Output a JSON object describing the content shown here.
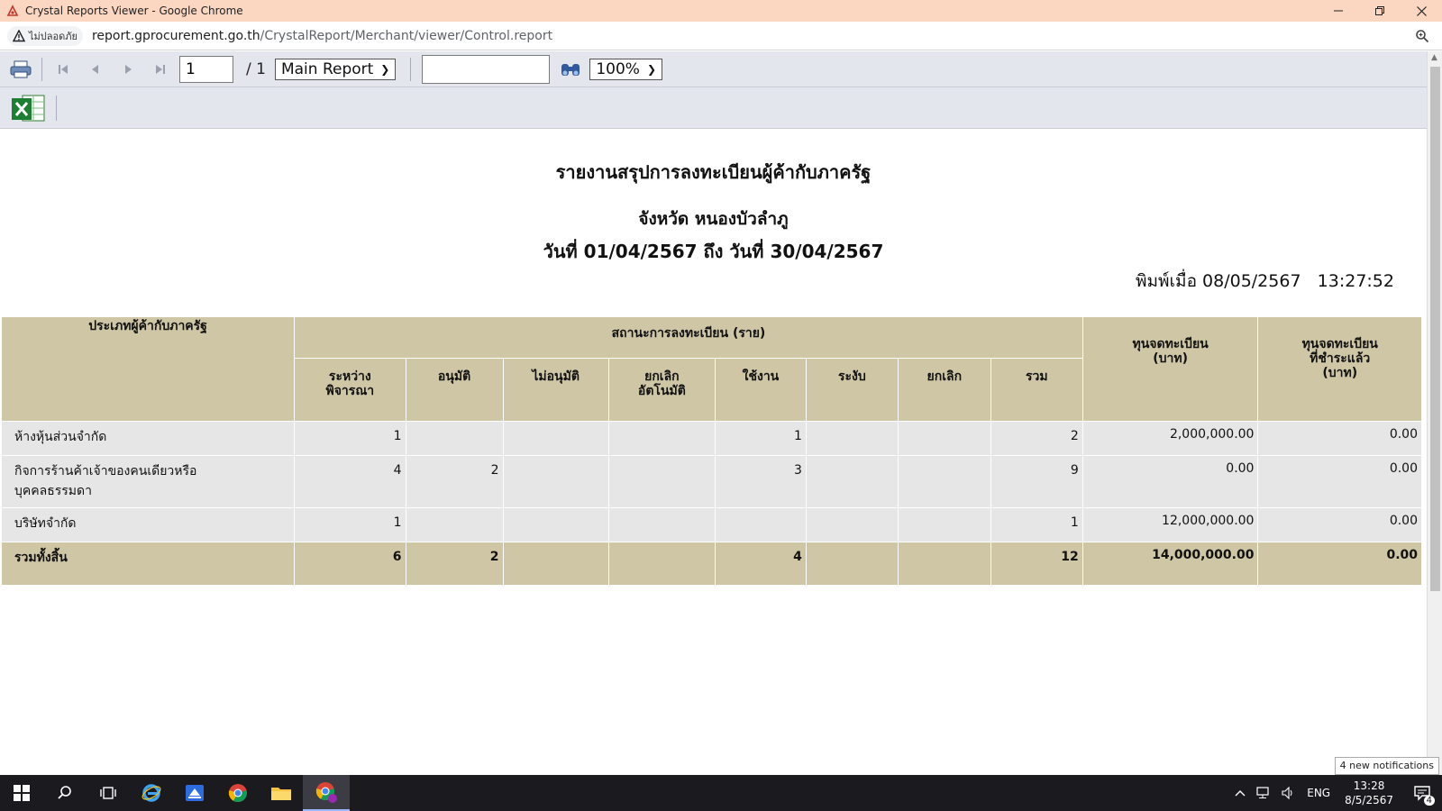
{
  "window": {
    "title": "Crystal Reports Viewer - Google Chrome"
  },
  "address": {
    "security_label": "ไม่ปลอดภัย",
    "host": "report.gprocurement.go.th",
    "path": "/CrystalReport/Merchant/viewer/Control.report"
  },
  "toolbar": {
    "page_value": "1",
    "page_total": "/ 1",
    "report_select": "Main Report",
    "search_value": "",
    "zoom_select": "100%"
  },
  "report": {
    "title": "รายงานสรุปการลงทะเบียนผู้ค้ากับภาครัฐ",
    "province": "จังหวัด หนองบัวลำภู",
    "date_range": "วันที่ 01/04/2567 ถึง วันที่ 30/04/2567",
    "printed_at": "พิมพ์เมื่อ 08/05/2567   13:27:52",
    "headers": {
      "type": "ประเภทผู้ค้ากับภาครัฐ",
      "status_group": "สถานะการลงทะเบียน (ราย)",
      "cols": [
        "ระหว่าง\nพิจารณา",
        "อนุมัติ",
        "ไม่อนุมัติ",
        "ยกเลิก\nอัตโนมัติ",
        "ใช้งาน",
        "ระงับ",
        "ยกเลิก",
        "รวม"
      ],
      "capital": "ทุนจดทะเบียน\n(บาท)",
      "paid_capital": "ทุนจดทะเบียน\nที่ชำระแล้ว\n(บาท)"
    },
    "rows": [
      {
        "name": "ห้างหุ้นส่วนจำกัด",
        "values": [
          "1",
          "",
          "",
          "",
          "1",
          "",
          "",
          "2"
        ],
        "capital": "2,000,000.00",
        "paid": "0.00"
      },
      {
        "name": "กิจการร้านค้าเจ้าของคนเดียวหรือ\nบุคคลธรรมดา",
        "values": [
          "4",
          "2",
          "",
          "",
          "3",
          "",
          "",
          "9"
        ],
        "capital": "0.00",
        "paid": "0.00"
      },
      {
        "name": "บริษัทจำกัด",
        "values": [
          "1",
          "",
          "",
          "",
          "",
          "",
          "",
          "1"
        ],
        "capital": "12,000,000.00",
        "paid": "0.00"
      }
    ],
    "total": {
      "name": "รวมทั้งสิ้น",
      "values": [
        "6",
        "2",
        "",
        "",
        "4",
        "",
        "",
        "12"
      ],
      "capital": "14,000,000.00",
      "paid": "0.00"
    }
  },
  "taskbar": {
    "lang": "ENG",
    "time": "13:28",
    "date": "8/5/2567",
    "notif_count": "4",
    "notif_tip": "4 new notifications"
  },
  "colors": {
    "header_bg": "#cfc6a6",
    "cell_bg": "#e6e6e6",
    "titlebar_bg": "#fbd7c2"
  }
}
